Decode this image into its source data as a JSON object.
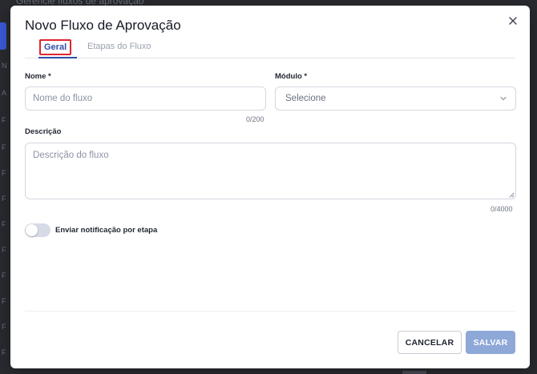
{
  "background": {
    "page_title": "Gerencie fluxos de aprovação",
    "row_marks": [
      "N",
      "A",
      "F",
      "F",
      "F",
      "F",
      "F",
      "F",
      "F",
      "F",
      "F",
      "F"
    ]
  },
  "modal": {
    "title": "Novo Fluxo de Aprovação",
    "close_icon": "close-icon",
    "tabs": [
      {
        "label": "Geral",
        "active": true
      },
      {
        "label": "Etapas do Fluxo",
        "active": false
      }
    ],
    "fields": {
      "nome": {
        "label": "Nome *",
        "placeholder": "Nome do fluxo",
        "value": "",
        "counter": "0/200"
      },
      "modulo": {
        "label": "Módulo *",
        "selected": "Selecione"
      },
      "descricao": {
        "label": "Descrição",
        "placeholder": "Descrição do fluxo",
        "value": "",
        "counter": "0/4000"
      }
    },
    "toggle": {
      "label": "Enviar notificação por etapa",
      "checked": false
    },
    "buttons": {
      "cancel": "CANCELAR",
      "save": "SALVAR"
    }
  },
  "colors": {
    "accent": "#2f4ea8",
    "highlight_box": "#e0262e",
    "save_button": "#8ea8d8",
    "overlay": "#1e1f23"
  }
}
